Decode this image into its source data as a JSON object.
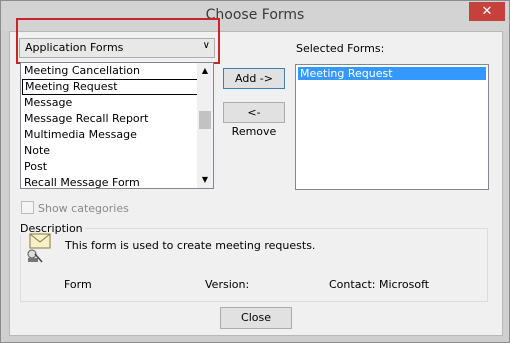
{
  "window": {
    "title": "Choose Forms",
    "close_glyph": "✕"
  },
  "form_library": {
    "selected": "Application Forms",
    "arrow": "∨"
  },
  "available_forms": {
    "items": [
      "Meeting Cancellation",
      "Meeting Request",
      "Message",
      "Message Recall Report",
      "Multimedia Message",
      "Note",
      "Post",
      "Recall Message Form"
    ],
    "focused_index": 1,
    "scroll_up": "▲",
    "scroll_down": "▼"
  },
  "buttons": {
    "add": "Add ->",
    "remove": "<- Remove",
    "close": "Close"
  },
  "selected_forms": {
    "label": "Selected Forms:",
    "items": [
      "Meeting Request"
    ]
  },
  "show_categories": {
    "label": "Show categories",
    "checked": false
  },
  "description": {
    "label": "Description",
    "text": "This form is used to create meeting requests.",
    "form_label": "Form",
    "version_label": "Version:",
    "contact_label": "Contact: Microsoft",
    "icon": "meeting-form-icon"
  },
  "colors": {
    "selection": "#3399ff",
    "highlight_box": "#c8242c"
  }
}
